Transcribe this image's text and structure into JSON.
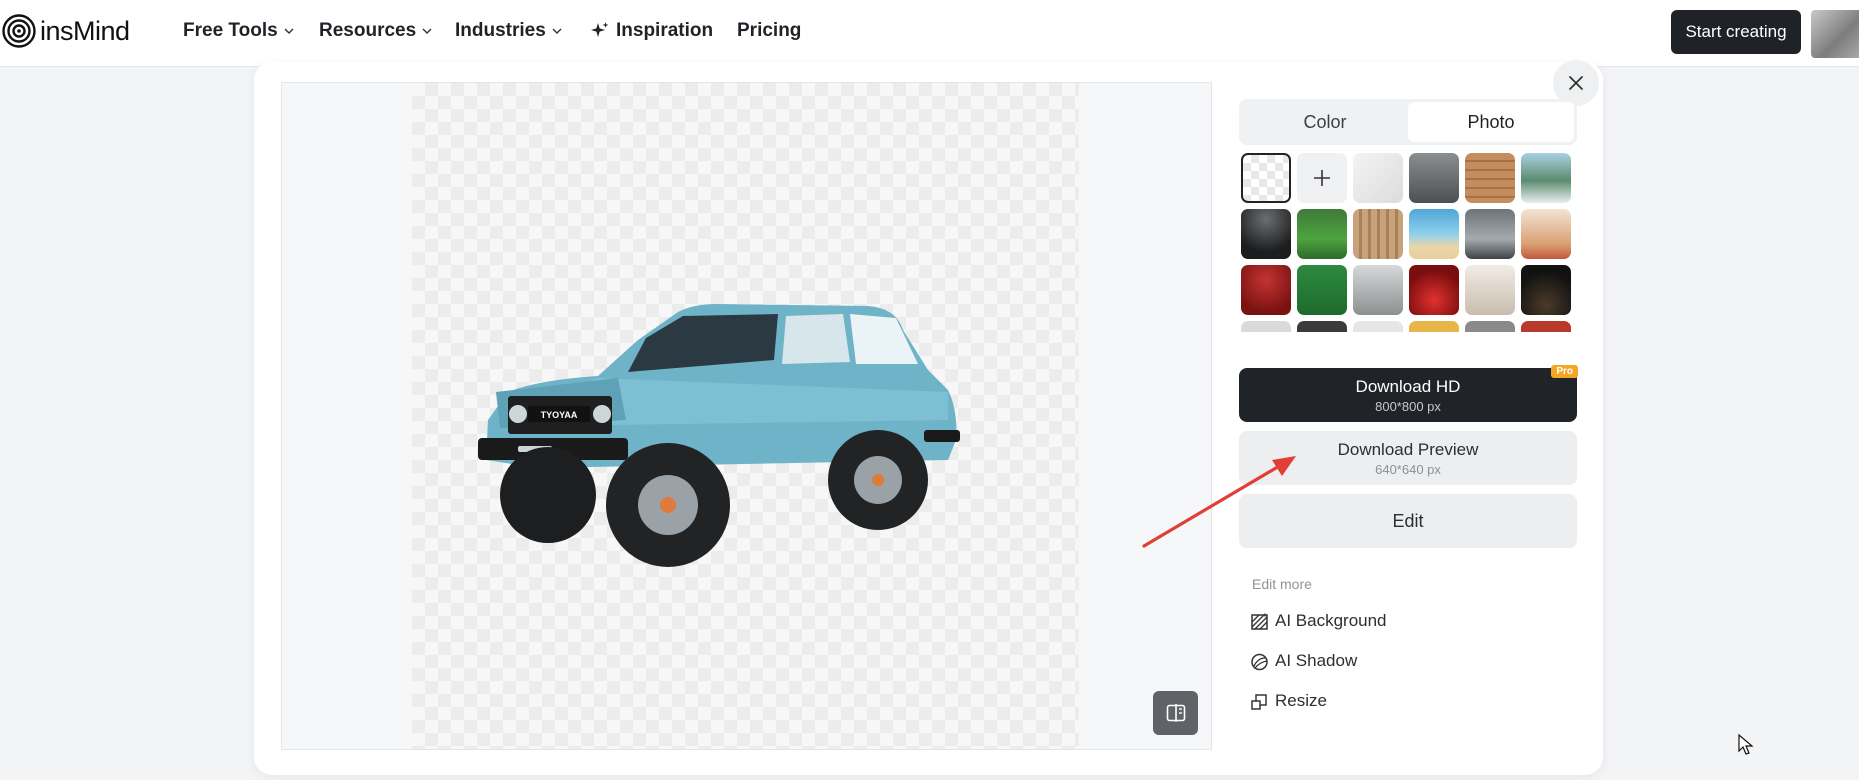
{
  "brand": {
    "name": "insMind"
  },
  "nav": {
    "items": [
      {
        "label": "Free Tools",
        "dropdown": true
      },
      {
        "label": "Resources",
        "dropdown": true
      },
      {
        "label": "Industries",
        "dropdown": true
      },
      {
        "label": "Inspiration",
        "icon": "sparkle-icon"
      },
      {
        "label": "Pricing"
      }
    ],
    "start_label": "Start creating"
  },
  "panel": {
    "tabs": [
      {
        "label": "Color",
        "active": false
      },
      {
        "label": "Photo",
        "active": true
      }
    ],
    "download_hd": {
      "label": "Download HD",
      "size": "800*800 px",
      "badge": "Pro"
    },
    "download_preview": {
      "label": "Download Preview",
      "size": "640*640 px"
    },
    "edit_label": "Edit",
    "edit_more_label": "Edit more",
    "tools": [
      {
        "label": "AI Background",
        "icon": "ai-background-icon"
      },
      {
        "label": "AI Shadow",
        "icon": "ai-shadow-icon"
      },
      {
        "label": "Resize",
        "icon": "resize-icon"
      }
    ]
  },
  "preview": {
    "plate_text": "TYOYAA"
  },
  "colors": {
    "accent_dark": "#202327",
    "pro_badge": "#f5a623",
    "arrow": "#e03e36"
  }
}
